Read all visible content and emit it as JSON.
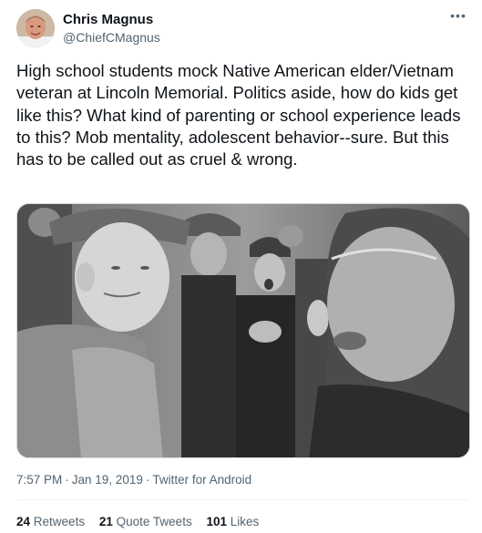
{
  "author": {
    "display_name": "Chris Magnus",
    "handle": "@ChiefCMagnus",
    "more_icon": "•••"
  },
  "tweet": {
    "text": "High school students mock Native American elder/Vietnam veteran at Lincoln Memorial. Politics aside, how do kids get like this? What kind of parenting or school experience leads to this? Mob mentality, adolescent behavior--sure. But this has to be called out as cruel & wrong."
  },
  "meta": {
    "time": "7:57 PM",
    "separator": "·",
    "date": "Jan 19, 2019",
    "source": "Twitter for Android"
  },
  "stats": {
    "retweets_count": "24",
    "retweets_label": "Retweets",
    "quotes_count": "21",
    "quotes_label": "Quote Tweets",
    "likes_count": "101",
    "likes_label": "Likes"
  },
  "colors": {
    "text_primary": "#0f1419",
    "text_secondary": "#536471",
    "divider": "#eff3f4"
  }
}
